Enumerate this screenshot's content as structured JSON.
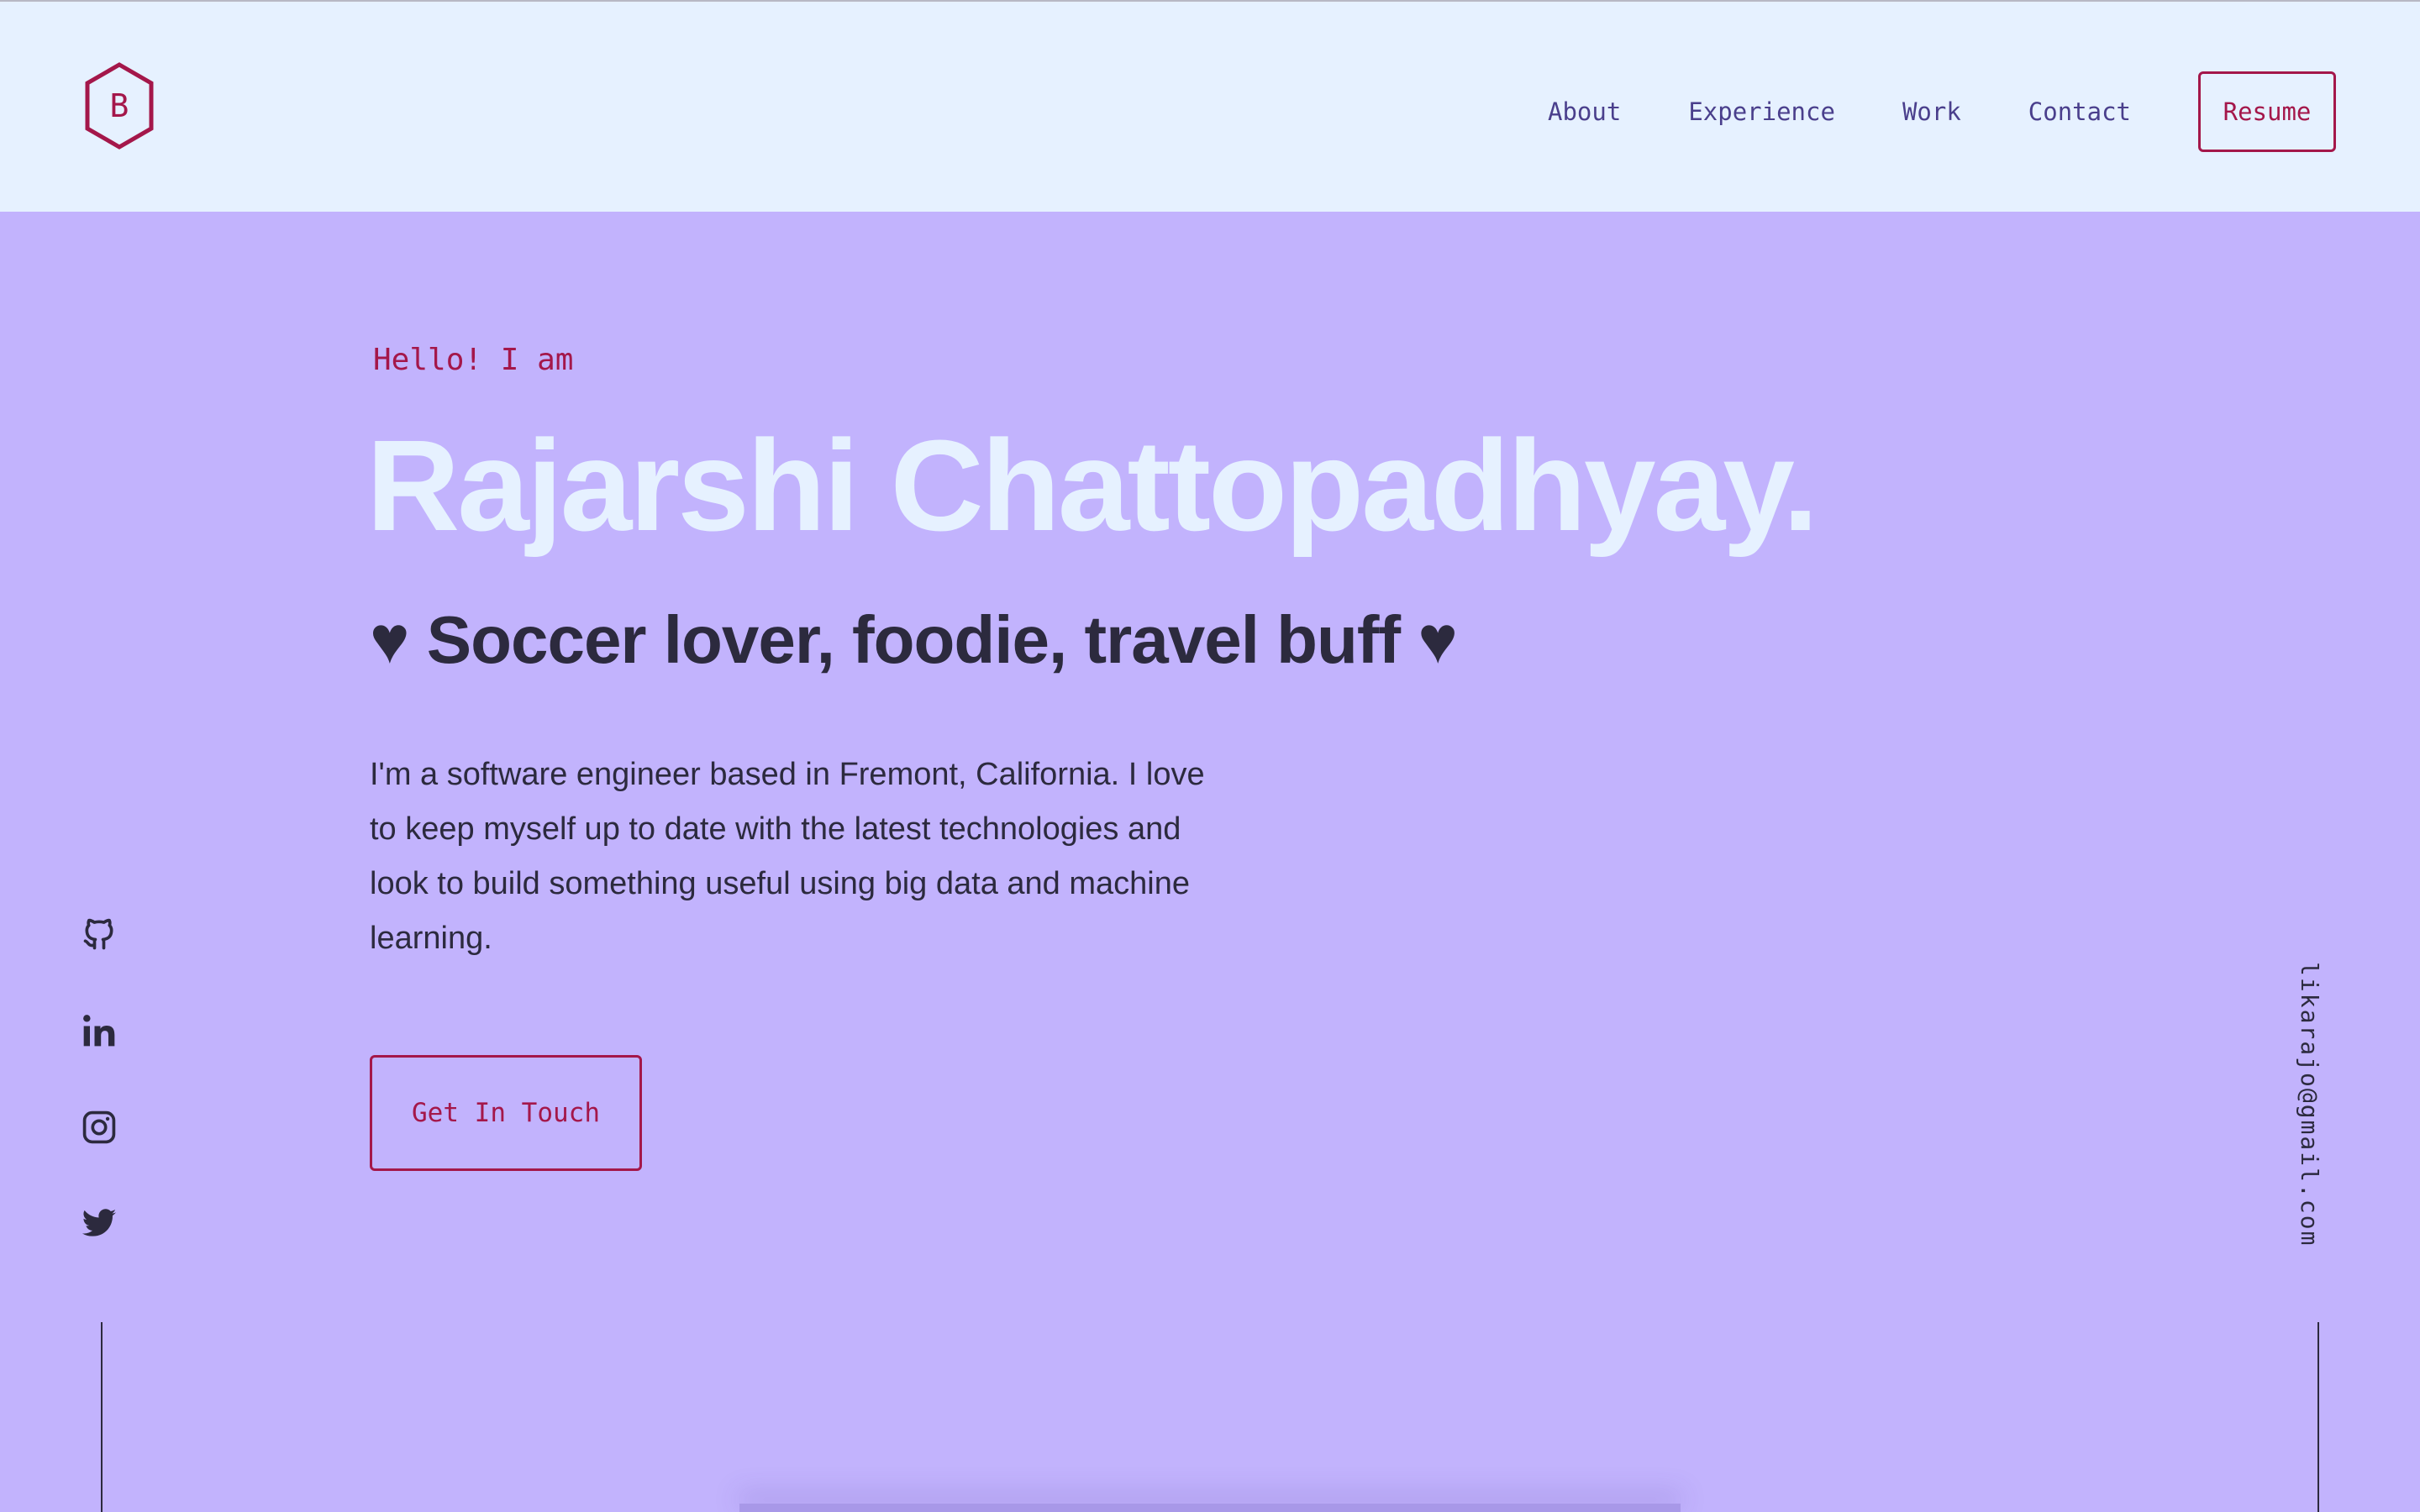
{
  "header": {
    "logo_letter": "B",
    "nav": [
      {
        "label": "About"
      },
      {
        "label": "Experience"
      },
      {
        "label": "Work"
      },
      {
        "label": "Contact"
      }
    ],
    "resume_label": "Resume"
  },
  "hero": {
    "greeting": "Hello! I am",
    "name": "Rajarshi Chattopadhyay.",
    "tagline": "♥ Soccer lover, foodie, travel buff ♥",
    "bio": "I'm a software engineer based in Fremont, California. I love to keep myself up to date with the latest technologies and look to build something useful using big data and machine learning.",
    "cta_label": "Get In Touch"
  },
  "social": {
    "icons": [
      "github-icon",
      "linkedin-icon",
      "instagram-icon",
      "twitter-icon"
    ]
  },
  "email": "likarajo@gmail.com",
  "colors": {
    "background": "#c2b3fd",
    "header": "#e6f1ff",
    "accent": "#a4174a",
    "nav_text": "#4a3f8c",
    "dark_text": "#2c2a3e",
    "name_text": "#e6f1ff"
  }
}
